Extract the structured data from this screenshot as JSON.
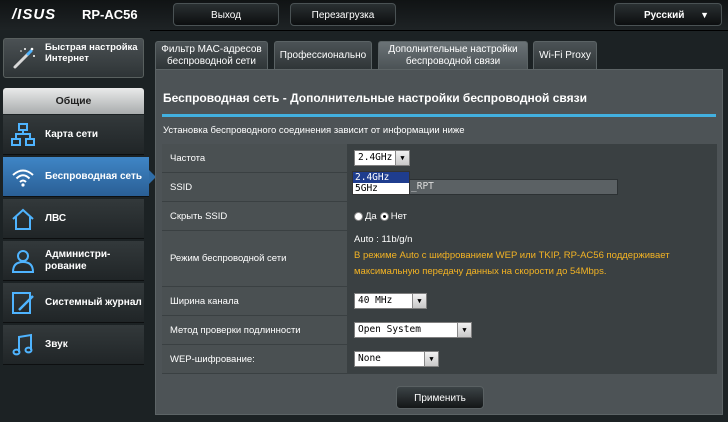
{
  "header": {
    "logo": "/ISUS",
    "model": "RP-AC56",
    "logout_label": "Выход",
    "reboot_label": "Перезагрузка",
    "language": "Русский",
    "language_caret_icon": "triangle-down-icon"
  },
  "sidebar": {
    "quick_setup": "Быстрая настройка Интернет",
    "section_general": "Общие",
    "items": [
      {
        "label": "Карта сети",
        "icon": "network-map-icon"
      },
      {
        "label": "Беспроводная сеть",
        "icon": "wifi-icon",
        "active": true
      },
      {
        "label": "ЛВС",
        "icon": "lan-icon"
      },
      {
        "label": "Администри-рование",
        "icon": "admin-icon"
      },
      {
        "label": "Системный журнал",
        "icon": "log-icon"
      },
      {
        "label": "Звук",
        "icon": "music-icon"
      }
    ]
  },
  "tabs": [
    {
      "label": "Фильтр MAC-адресов беспроводной сети"
    },
    {
      "label": "Профессионально"
    },
    {
      "label": "Дополнительные настройки беспроводной связи",
      "active": true
    },
    {
      "label": "Wi-Fi Proxy"
    }
  ],
  "panel": {
    "title": "Беспроводная сеть - Дополнительные настройки беспроводной связи",
    "description": "Установка беспроводного соединения зависит от информации ниже"
  },
  "form": {
    "frequency": {
      "label": "Частота",
      "value": "2.4GHz",
      "options": [
        "2.4GHz",
        "5GHz"
      ],
      "highlighted": "2.4GHz"
    },
    "ssid": {
      "label": "SSID",
      "value": "_RPT"
    },
    "hide_ssid": {
      "label": "Скрыть SSID",
      "yes": "Да",
      "no": "Нет",
      "selected": "Нет"
    },
    "mode": {
      "label": "Режим беспроводной сети",
      "value": "Auto : 11b/g/n",
      "note": "В режиме Auto с шифрованием WEP или TKIP, RP-AC56 поддерживает максимальную передачу данных на скорости до 54Mbps."
    },
    "bandwidth": {
      "label": "Ширина канала",
      "value": "40 MHz"
    },
    "auth": {
      "label": "Метод проверки подлинности",
      "value": "Open System"
    },
    "wep": {
      "label": "WEP-шифрование:",
      "value": "None"
    }
  },
  "apply_label": "Применить"
}
